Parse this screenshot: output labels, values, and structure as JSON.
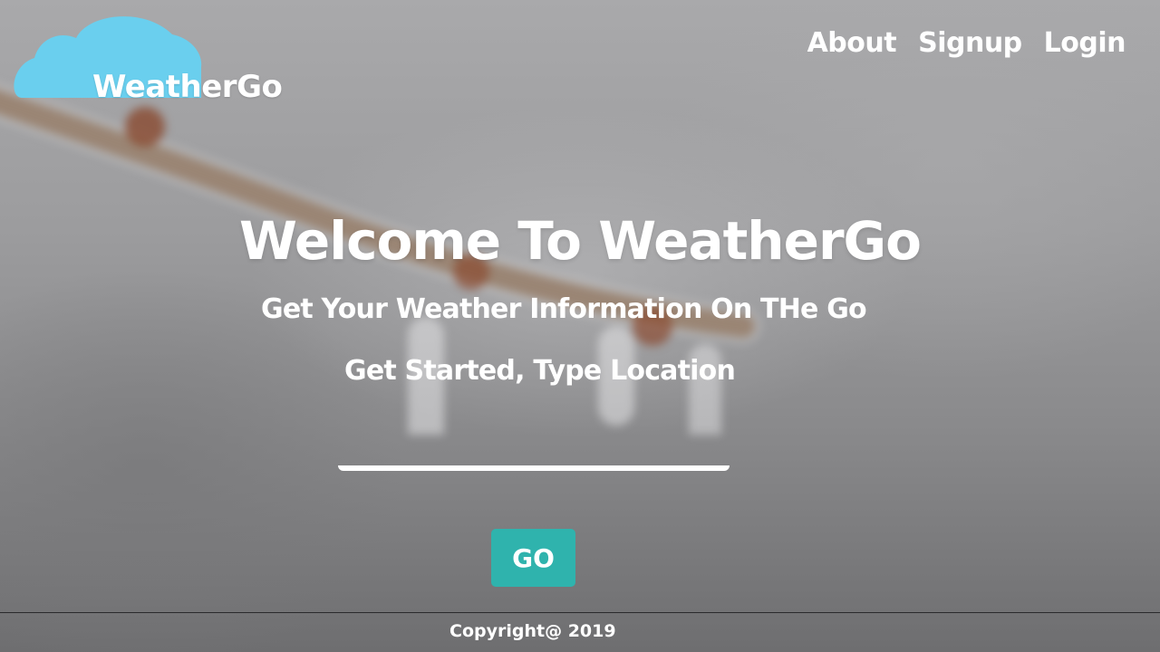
{
  "brand": {
    "name": "WeatherGo",
    "cloud_color": "#6acfee"
  },
  "nav": {
    "items": [
      "About",
      "Signup",
      "Login"
    ]
  },
  "hero": {
    "title": "Welcome To WeatherGo",
    "subtitle": "Get Your Weather Information On THe Go",
    "prompt": "Get Started, Type Location"
  },
  "search": {
    "value": "",
    "placeholder": ""
  },
  "actions": {
    "go_label": "GO",
    "go_color": "#2fb3ad"
  },
  "footer": {
    "copyright": "Copyright@ 2019"
  }
}
